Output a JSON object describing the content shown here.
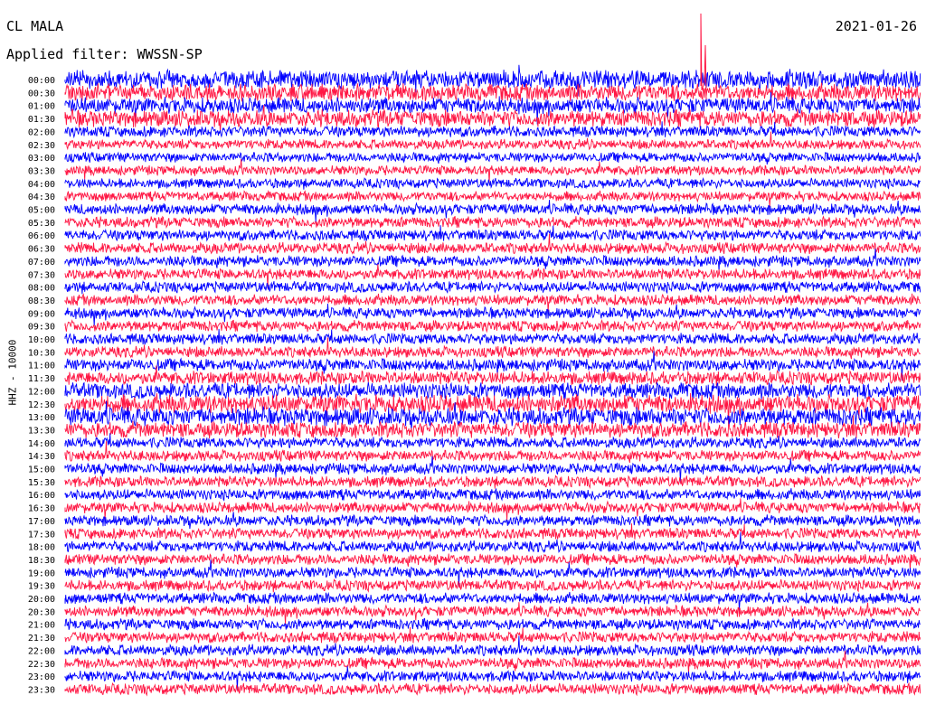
{
  "header": {
    "station": "CL MALA",
    "date": "2021-01-26",
    "filter": "Applied filter: WWSSN-SP"
  },
  "colors": {
    "odd": "#0000ff",
    "even": "#ff1744",
    "background": "#ffffff"
  },
  "chart_data": {
    "type": "line",
    "title": "CL MALA",
    "date": "2021-01-26",
    "filter": "WWSSN-SP",
    "ylabel": "HHZ - 10000",
    "row_labels": [
      "00:00",
      "00:30",
      "01:00",
      "01:30",
      "02:00",
      "02:30",
      "03:00",
      "03:30",
      "04:00",
      "04:30",
      "05:00",
      "05:30",
      "06:00",
      "06:30",
      "07:00",
      "07:30",
      "08:00",
      "08:30",
      "09:00",
      "09:30",
      "10:00",
      "10:30",
      "11:00",
      "11:30",
      "12:00",
      "12:30",
      "13:00",
      "13:30",
      "14:00",
      "14:30",
      "15:00",
      "15:30",
      "16:00",
      "16:30",
      "17:00",
      "17:30",
      "18:00",
      "18:30",
      "19:00",
      "19:30",
      "20:00",
      "20:30",
      "21:00",
      "21:30",
      "22:00",
      "22:30",
      "23:00",
      "23:30"
    ],
    "row_colors_alternate": [
      "#0000ff",
      "#ff1744"
    ],
    "relative_amplitude": [
      1.5,
      1.4,
      1.3,
      1.4,
      0.9,
      0.8,
      0.8,
      0.8,
      0.8,
      0.8,
      0.9,
      0.9,
      0.9,
      0.9,
      0.9,
      0.9,
      0.9,
      0.9,
      0.9,
      0.9,
      0.9,
      0.9,
      1.0,
      1.1,
      1.3,
      1.5,
      1.5,
      1.3,
      0.9,
      0.9,
      0.9,
      0.9,
      0.9,
      0.9,
      0.9,
      0.9,
      0.9,
      0.9,
      0.9,
      0.9,
      0.9,
      0.9,
      0.9,
      0.9,
      0.9,
      0.9,
      0.9,
      0.9
    ]
  }
}
